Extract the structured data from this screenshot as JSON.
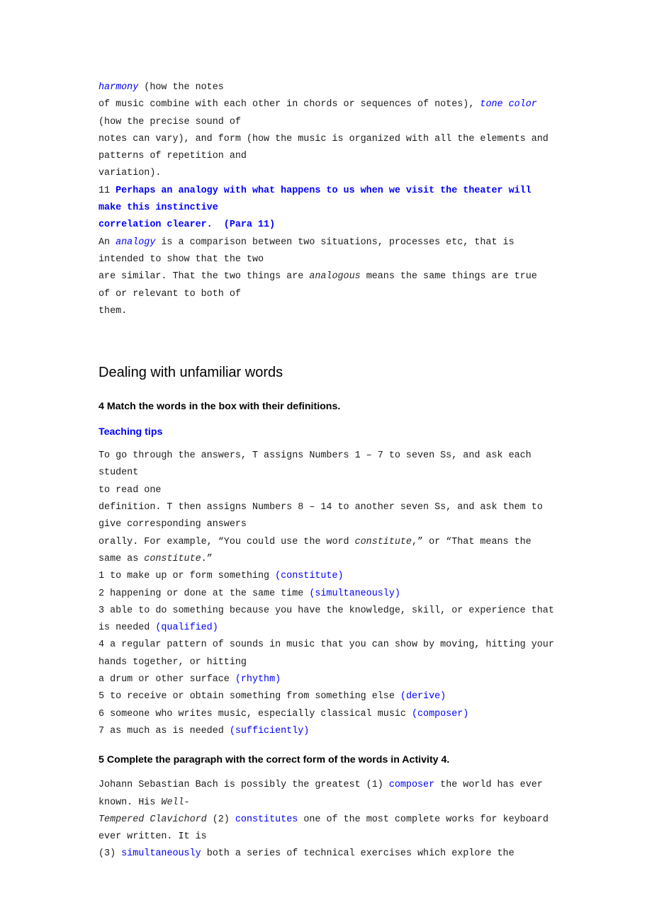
{
  "document": {
    "page_background": "#ffffff",
    "text_color": "#1a1a1a",
    "accent_color": "#0000ff"
  },
  "top_passage": {
    "lines": [
      [
        {
          "t": "harmony",
          "style": "blue-italic"
        },
        {
          "t": " (how the notes",
          "style": "plain"
        }
      ],
      [
        {
          "t": "of music combine with each other in chords or sequences of notes), ",
          "style": "plain"
        },
        {
          "t": "tone color",
          "style": "blue-italic"
        }
      ],
      [
        {
          "t": "(how the precise sound of",
          "style": "plain"
        }
      ],
      [
        {
          "t": "notes can vary), and form (how the music is organized with all the elements and",
          "style": "plain"
        }
      ],
      [
        {
          "t": "patterns of repetition and",
          "style": "plain"
        }
      ],
      [
        {
          "t": "variation).",
          "style": "plain"
        }
      ],
      [
        {
          "t": "11 ",
          "style": "plain"
        },
        {
          "t": "Perhaps an analogy with what happens to us when we visit the theater will",
          "style": "blue-bold"
        }
      ],
      [
        {
          "t": "make this instinctive",
          "style": "blue-bold"
        }
      ],
      [
        {
          "t": "correlation clearer.  (Para 11)",
          "style": "blue-bold"
        }
      ],
      [
        {
          "t": "An ",
          "style": "plain"
        },
        {
          "t": "analogy",
          "style": "blue-italic"
        },
        {
          "t": " is a comparison between two situations, processes etc, that is",
          "style": "plain"
        }
      ],
      [
        {
          "t": "intended to show that the two",
          "style": "plain"
        }
      ],
      [
        {
          "t": "are similar. That the two things are ",
          "style": "plain"
        },
        {
          "t": "analogous",
          "style": "italic"
        },
        {
          "t": " means the same things are true",
          "style": "plain"
        }
      ],
      [
        {
          "t": "of or relevant to both of",
          "style": "plain"
        }
      ],
      [
        {
          "t": "them.",
          "style": "plain"
        }
      ]
    ]
  },
  "section": {
    "heading": "Dealing with unfamiliar words",
    "activity4_title": "4 Match the words in the box with their definitions.",
    "teaching_tips_label": "Teaching tips",
    "teaching_tips_lines": [
      [
        {
          "t": "To go through the answers, T assigns Numbers 1 – 7 to seven Ss, and ask each student",
          "style": "plain"
        }
      ],
      [
        {
          "t": "to read one",
          "style": "plain"
        }
      ],
      [
        {
          "t": "definition. T then assigns Numbers 8 – 14 to another seven Ss, and ask them to",
          "style": "plain"
        }
      ],
      [
        {
          "t": "give corresponding answers",
          "style": "plain"
        }
      ],
      [
        {
          "t": "orally. For example, “You could use the word ",
          "style": "plain"
        },
        {
          "t": "constitute",
          "style": "italic"
        },
        {
          "t": ",” or “That means the",
          "style": "plain"
        }
      ],
      [
        {
          "t": "same as ",
          "style": "plain"
        },
        {
          "t": "constitute",
          "style": "italic"
        },
        {
          "t": ".”",
          "style": "plain"
        }
      ]
    ],
    "definitions": [
      [
        {
          "t": "1 to make up or form something ",
          "style": "plain"
        },
        {
          "t": "(constitute)",
          "style": "blue"
        }
      ],
      [
        {
          "t": "2 happening or done at the same time ",
          "style": "plain"
        },
        {
          "t": "(simultaneously)",
          "style": "blue"
        }
      ],
      [
        {
          "t": "3 able to do something because you have the knowledge, skill, or experience that",
          "style": "plain"
        }
      ],
      [
        {
          "t": "is needed ",
          "style": "plain"
        },
        {
          "t": "(qualified)",
          "style": "blue"
        }
      ],
      [
        {
          "t": "4 a regular pattern of sounds in music that you can show by moving, hitting your",
          "style": "plain"
        }
      ],
      [
        {
          "t": "hands together, or hitting",
          "style": "plain"
        }
      ],
      [
        {
          "t": "a drum or other surface ",
          "style": "plain"
        },
        {
          "t": "(rhythm)",
          "style": "blue"
        }
      ],
      [
        {
          "t": "5 to receive or obtain something from something else ",
          "style": "plain"
        },
        {
          "t": "(derive)",
          "style": "blue"
        }
      ],
      [
        {
          "t": "6 someone who writes music, especially classical music ",
          "style": "plain"
        },
        {
          "t": "(composer)",
          "style": "blue"
        }
      ],
      [
        {
          "t": "7 as much as is needed ",
          "style": "plain"
        },
        {
          "t": "(sufficiently)",
          "style": "blue"
        }
      ]
    ],
    "activity5_title": "5 Complete the paragraph with the correct form of the words in Activity 4.",
    "activity5_lines": [
      [
        {
          "t": "Johann Sebastian Bach is possibly the greatest (1) ",
          "style": "plain"
        },
        {
          "t": "composer",
          "style": "blue"
        },
        {
          "t": " the world has ever",
          "style": "plain"
        }
      ],
      [
        {
          "t": "known. His ",
          "style": "plain"
        },
        {
          "t": "Well-",
          "style": "italic"
        }
      ],
      [
        {
          "t": "Tempered Clavichord",
          "style": "italic"
        },
        {
          "t": " (2) ",
          "style": "plain"
        },
        {
          "t": "constitutes",
          "style": "blue"
        },
        {
          "t": " one of the most complete works for keyboard",
          "style": "plain"
        }
      ],
      [
        {
          "t": "ever written. It is",
          "style": "plain"
        }
      ],
      [
        {
          "t": "(3) ",
          "style": "plain"
        },
        {
          "t": "simultaneously",
          "style": "blue"
        },
        {
          "t": " both a series of technical exercises which explore the",
          "style": "plain"
        }
      ]
    ]
  }
}
